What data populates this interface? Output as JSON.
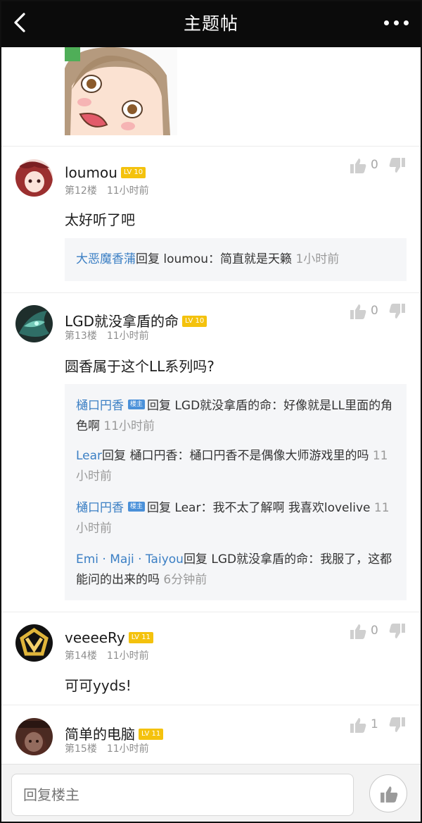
{
  "header": {
    "title": "主题帖"
  },
  "posts": [
    {
      "username": "loumou",
      "level": "LV 10",
      "floor": "第12楼",
      "time": "11小时前",
      "likes": "0",
      "content": "太好听了吧",
      "replies": [
        {
          "author": "大恶魔香蒲",
          "reply_word": "回复",
          "target": "loumou",
          "text": "：简直就是天籁",
          "time": "1小时前"
        }
      ]
    },
    {
      "username": "LGD就没拿盾的命",
      "level": "LV 10",
      "floor": "第13楼",
      "time": "11小时前",
      "likes": "0",
      "content": "圆香属于这个LL系列吗?",
      "replies": [
        {
          "author": "樋口円香",
          "badge": "楼主",
          "reply_word": "回复",
          "target": "LGD就没拿盾的命",
          "text": "：好像就是LL里面的角色啊",
          "time": "11小时前"
        },
        {
          "author": "Lear",
          "reply_word": "回复",
          "target": "樋口円香",
          "text": "：樋口円香不是偶像大师游戏里的吗",
          "time": "11小时前"
        },
        {
          "author": "樋口円香",
          "badge": "楼主",
          "reply_word": "回复",
          "target": "Lear",
          "text": "：我不太了解啊 我喜欢lovelive",
          "time": "11小时前"
        },
        {
          "author": "Emi · Maji · Taiyou",
          "reply_word": "回复",
          "target": "LGD就没拿盾的命",
          "text": "：我服了，这都能问的出来的吗",
          "time": "6分钟前"
        }
      ]
    },
    {
      "username": "veeeeRy",
      "level": "LV 11",
      "floor": "第14楼",
      "time": "11小时前",
      "likes": "0",
      "content": "可可yyds!"
    },
    {
      "username": "简单的电脑",
      "level": "LV 11",
      "floor": "第15楼",
      "time": "11小时前",
      "likes": "1"
    }
  ],
  "bottom": {
    "reply_placeholder": "回复楼主"
  },
  "colors": {
    "header_bg": "#0b0b0b",
    "level_badge": "#f4c20d",
    "reply_link": "#3b7fc4",
    "owner_badge": "#4a90d9"
  },
  "icons": [
    "back-arrow-icon",
    "more-dots-icon",
    "thumbs-up-icon",
    "thumbs-down-icon"
  ]
}
